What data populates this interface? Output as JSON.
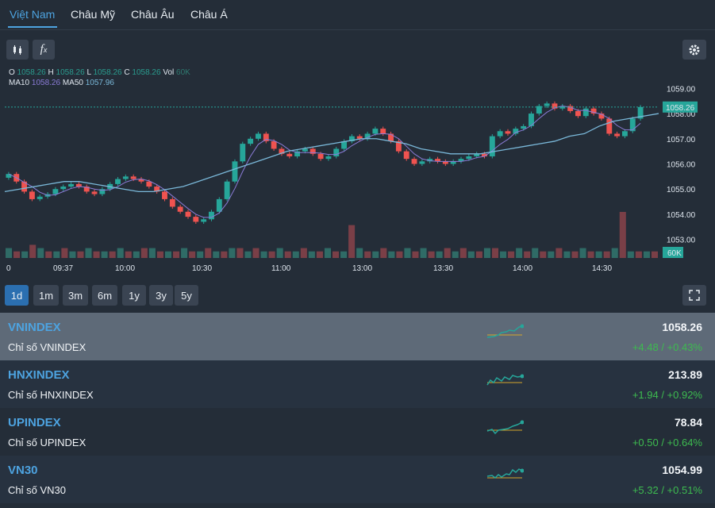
{
  "tabs": [
    "Việt Nam",
    "Châu Mỹ",
    "Châu Âu",
    "Châu Á"
  ],
  "toolbar": {
    "candle_icon": "candlestick-icon",
    "fx_label": "f",
    "fx_sub": "x",
    "settings_icon": "gear-icon"
  },
  "legend": {
    "o_label": "O",
    "o_value": "1058.26",
    "h_label": "H",
    "h_value": "1058.26",
    "l_label": "L",
    "l_value": "1058.26",
    "c_label": "C",
    "c_value": "1058.26",
    "vol_label": "Vol",
    "vol_value": "60K",
    "ma10_label": "MA10",
    "ma10_value": "1058.26",
    "ma50_label": "MA50",
    "ma50_value": "1057.96"
  },
  "chart_data": {
    "type": "candlestick",
    "y_ticks": [
      "1059.00",
      "1058.00",
      "1057.00",
      "1056.00",
      "1055.00",
      "1054.00",
      "1053.00"
    ],
    "ylim": [
      1052.8,
      1059.2
    ],
    "x_ticks": [
      "0",
      "09:37",
      "10:00",
      "10:30",
      "11:00",
      "13:00",
      "13:30",
      "14:00",
      "14:30"
    ],
    "last_price_label": "1058.26",
    "volume_label": "60K",
    "close_series": [
      1055.6,
      1055.3,
      1054.9,
      1054.6,
      1054.7,
      1054.8,
      1055.0,
      1055.1,
      1055.2,
      1055.1,
      1054.9,
      1054.8,
      1055.0,
      1055.2,
      1055.4,
      1055.5,
      1055.4,
      1055.3,
      1055.1,
      1054.9,
      1054.6,
      1054.3,
      1054.1,
      1053.9,
      1053.7,
      1053.8,
      1054.1,
      1054.6,
      1055.3,
      1056.1,
      1056.8,
      1057.0,
      1057.2,
      1056.9,
      1056.6,
      1056.4,
      1056.3,
      1056.5,
      1056.6,
      1056.4,
      1056.2,
      1056.3,
      1056.6,
      1056.9,
      1057.1,
      1057.0,
      1057.2,
      1057.4,
      1057.2,
      1056.9,
      1056.5,
      1056.2,
      1056.0,
      1056.1,
      1056.2,
      1056.1,
      1056.0,
      1056.1,
      1056.2,
      1056.3,
      1056.4,
      1056.3,
      1057.1,
      1057.3,
      1057.2,
      1057.4,
      1057.5,
      1058.0,
      1058.3,
      1058.4,
      1058.2,
      1058.3,
      1058.1,
      1057.9,
      1058.2,
      1058.0,
      1057.8,
      1057.2,
      1057.1,
      1057.3,
      1057.8,
      1058.26
    ],
    "ma50_series": [
      1054.9,
      1055.0,
      1055.1,
      1055.2,
      1055.3,
      1055.3,
      1055.2,
      1055.1,
      1055.0,
      1054.9,
      1054.9,
      1055.0,
      1055.1,
      1055.3,
      1055.5,
      1055.7,
      1055.9,
      1056.1,
      1056.3,
      1056.5,
      1056.6,
      1056.7,
      1056.8,
      1056.9,
      1057.0,
      1057.0,
      1056.9,
      1056.8,
      1056.6,
      1056.5,
      1056.4,
      1056.4,
      1056.4,
      1056.5,
      1056.6,
      1056.7,
      1056.8,
      1056.9,
      1057.1,
      1057.2,
      1057.5,
      1057.7,
      1057.8,
      1057.9,
      1058.0
    ],
    "volume": [
      3,
      2,
      2,
      4,
      3,
      2,
      2,
      3,
      2,
      2,
      3,
      2,
      2,
      2,
      3,
      2,
      2,
      3,
      3,
      2,
      2,
      2,
      3,
      2,
      2,
      3,
      2,
      2,
      3,
      3,
      2,
      3,
      2,
      2,
      3,
      2,
      2,
      3,
      2,
      2,
      3,
      2,
      2,
      10,
      3,
      2,
      2,
      3,
      2,
      2,
      3,
      2,
      3,
      2,
      2,
      3,
      2,
      3,
      2,
      2,
      3,
      3,
      2,
      2,
      3,
      2,
      3,
      2,
      2,
      3,
      2,
      2,
      3,
      2,
      2,
      2,
      3,
      14,
      2,
      2,
      2,
      2
    ]
  },
  "ranges": [
    "1d",
    "1m",
    "3m",
    "6m",
    "1y",
    "3y",
    "5y"
  ],
  "expand_icon": "expand-icon",
  "indices": [
    {
      "code": "VNINDEX",
      "name": "Chỉ số VNINDEX",
      "value": "1058.26",
      "change": "+4.48 / +0.43%"
    },
    {
      "code": "HNXINDEX",
      "name": "Chỉ số HNXINDEX",
      "value": "213.89",
      "change": "+1.94 / +0.92%"
    },
    {
      "code": "UPINDEX",
      "name": "Chỉ số UPINDEX",
      "value": "78.84",
      "change": "+0.50 / +0.64%"
    },
    {
      "code": "VN30",
      "name": "Chỉ số VN30",
      "value": "1054.99",
      "change": "+5.32 / +0.51%"
    }
  ],
  "colors": {
    "accent": "#4da3e0",
    "up": "#26a69a",
    "down": "#ef5350",
    "ma10": "#8a7bd6",
    "ma50": "#7ab8d9",
    "positive_text": "#3dbb4f"
  }
}
